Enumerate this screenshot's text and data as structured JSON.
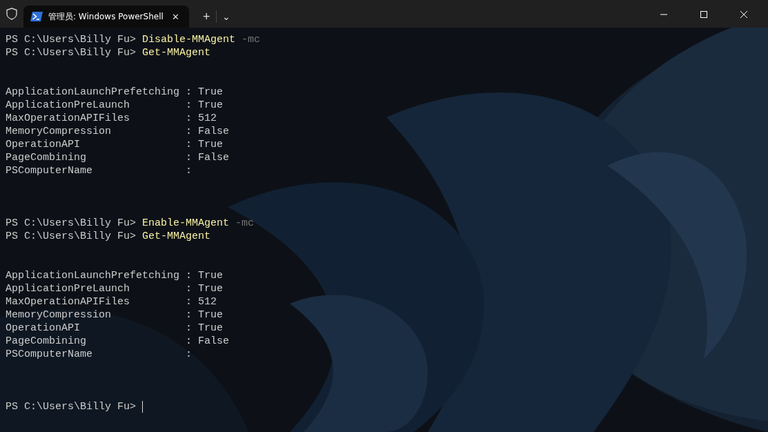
{
  "tabs": [
    {
      "title": "管理员: Windows PowerShell",
      "close": "✕",
      "selected": true
    }
  ],
  "tab_actions": {
    "new_tab": "+",
    "dropdown": "⌄"
  },
  "terminal": {
    "lines": [
      {
        "kind": "command",
        "prompt": "PS C:\\Users\\Billy Fu>",
        "command": "Disable-MMAgent",
        "parameter": "-mc"
      },
      {
        "kind": "command",
        "prompt": "PS C:\\Users\\Billy Fu>",
        "command": "Get-MMAgent"
      },
      {
        "kind": "blank"
      },
      {
        "kind": "blank"
      },
      {
        "kind": "output",
        "name": "ApplicationLaunchPrefetching",
        "separator": ":",
        "value": "True"
      },
      {
        "kind": "output",
        "name": "ApplicationPreLaunch",
        "separator": ":",
        "value": "True"
      },
      {
        "kind": "output",
        "name": "MaxOperationAPIFiles",
        "separator": ":",
        "value": "512"
      },
      {
        "kind": "output",
        "name": "MemoryCompression",
        "separator": ":",
        "value": "False"
      },
      {
        "kind": "output",
        "name": "OperationAPI",
        "separator": ":",
        "value": "True"
      },
      {
        "kind": "output",
        "name": "PageCombining",
        "separator": ":",
        "value": "False"
      },
      {
        "kind": "output",
        "name": "PSComputerName",
        "separator": ":"
      },
      {
        "kind": "blank"
      },
      {
        "kind": "blank"
      },
      {
        "kind": "blank"
      },
      {
        "kind": "command",
        "prompt": "PS C:\\Users\\Billy Fu>",
        "command": "Enable-MMAgent",
        "parameter": "-mc"
      },
      {
        "kind": "command",
        "prompt": "PS C:\\Users\\Billy Fu>",
        "command": "Get-MMAgent"
      },
      {
        "kind": "blank"
      },
      {
        "kind": "blank"
      },
      {
        "kind": "output",
        "name": "ApplicationLaunchPrefetching",
        "separator": ":",
        "value": "True"
      },
      {
        "kind": "output",
        "name": "ApplicationPreLaunch",
        "separator": ":",
        "value": "True"
      },
      {
        "kind": "output",
        "name": "MaxOperationAPIFiles",
        "separator": ":",
        "value": "512"
      },
      {
        "kind": "output",
        "name": "MemoryCompression",
        "separator": ":",
        "value": "True"
      },
      {
        "kind": "output",
        "name": "OperationAPI",
        "separator": ":",
        "value": "True"
      },
      {
        "kind": "output",
        "name": "PageCombining",
        "separator": ":",
        "value": "False"
      },
      {
        "kind": "output",
        "name": "PSComputerName",
        "separator": ":"
      },
      {
        "kind": "blank"
      },
      {
        "kind": "blank"
      },
      {
        "kind": "blank"
      },
      {
        "kind": "prompt",
        "prompt": "PS C:\\Users\\Billy Fu>",
        "cursor": true
      }
    ]
  }
}
